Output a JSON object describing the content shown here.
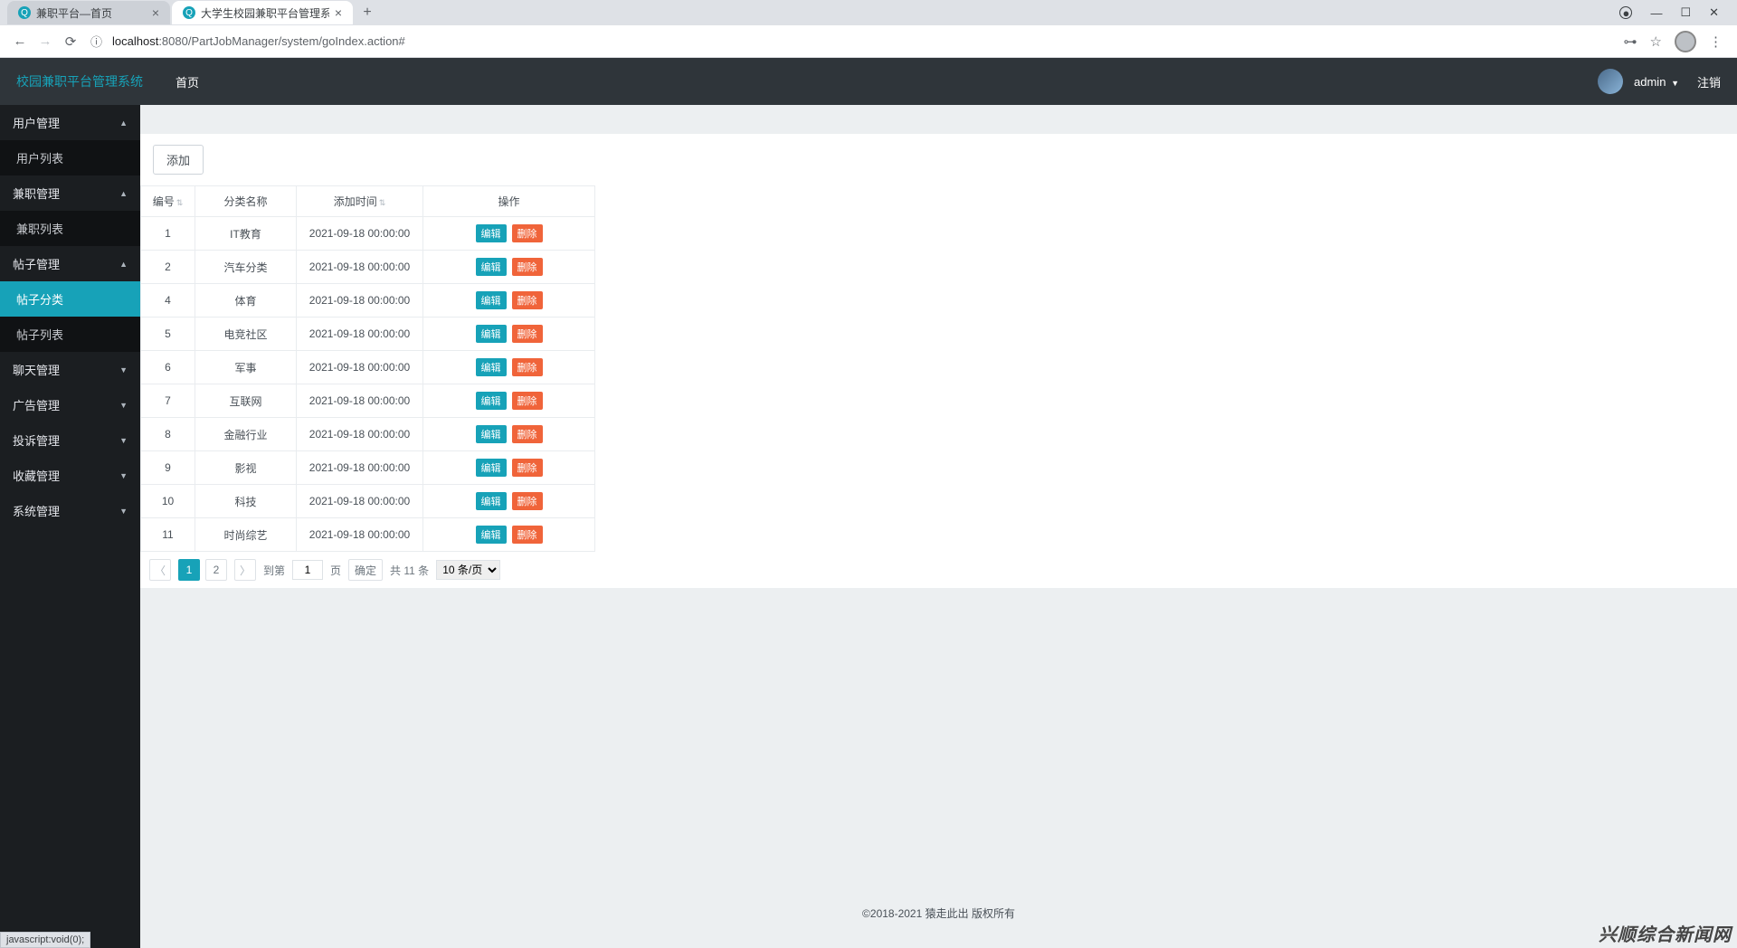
{
  "browser": {
    "tabs": [
      {
        "title": "兼职平台—首页",
        "active": false
      },
      {
        "title": "大学生校园兼职平台管理系统",
        "active": true
      }
    ],
    "url_host": "localhost",
    "url_path": ":8080/PartJobManager/system/goIndex.action#",
    "status_text": "javascript:void(0);"
  },
  "header": {
    "brand": "校园兼职平台管理系统",
    "home": "首页",
    "user": "admin",
    "logout": "注销"
  },
  "sidebar": [
    {
      "label": "用户管理",
      "type": "header",
      "open": true
    },
    {
      "label": "用户列表",
      "type": "sub"
    },
    {
      "label": "兼职管理",
      "type": "header",
      "open": true
    },
    {
      "label": "兼职列表",
      "type": "sub"
    },
    {
      "label": "帖子管理",
      "type": "header",
      "open": true
    },
    {
      "label": "帖子分类",
      "type": "sub",
      "active": true
    },
    {
      "label": "帖子列表",
      "type": "sub"
    },
    {
      "label": "聊天管理",
      "type": "header",
      "open": false
    },
    {
      "label": "广告管理",
      "type": "header",
      "open": false
    },
    {
      "label": "投诉管理",
      "type": "header",
      "open": false
    },
    {
      "label": "收藏管理",
      "type": "header",
      "open": false
    },
    {
      "label": "系统管理",
      "type": "header",
      "open": false
    }
  ],
  "toolbar": {
    "add": "添加"
  },
  "table": {
    "headers": {
      "id": "编号",
      "name": "分类名称",
      "time": "添加时间",
      "op": "操作"
    },
    "edit": "编辑",
    "del": "删除",
    "rows": [
      {
        "id": "1",
        "name": "IT教育",
        "time": "2021-09-18 00:00:00"
      },
      {
        "id": "2",
        "name": "汽车分类",
        "time": "2021-09-18 00:00:00"
      },
      {
        "id": "4",
        "name": "体育",
        "time": "2021-09-18 00:00:00"
      },
      {
        "id": "5",
        "name": "电竞社区",
        "time": "2021-09-18 00:00:00"
      },
      {
        "id": "6",
        "name": "军事",
        "time": "2021-09-18 00:00:00"
      },
      {
        "id": "7",
        "name": "互联网",
        "time": "2021-09-18 00:00:00"
      },
      {
        "id": "8",
        "name": "金融行业",
        "time": "2021-09-18 00:00:00"
      },
      {
        "id": "9",
        "name": "影视",
        "time": "2021-09-18 00:00:00"
      },
      {
        "id": "10",
        "name": "科技",
        "time": "2021-09-18 00:00:00"
      },
      {
        "id": "11",
        "name": "时尚综艺",
        "time": "2021-09-18 00:00:00"
      }
    ]
  },
  "pager": {
    "pages": [
      "1",
      "2"
    ],
    "current": "1",
    "goto_label": "到第",
    "page_suffix": "页",
    "goto_value": "1",
    "confirm": "确定",
    "total": "共 11 条",
    "per_page": "10 条/页"
  },
  "footer": "©2018-2021 猿走此出 版权所有",
  "watermark": "兴顺综合新闻网"
}
